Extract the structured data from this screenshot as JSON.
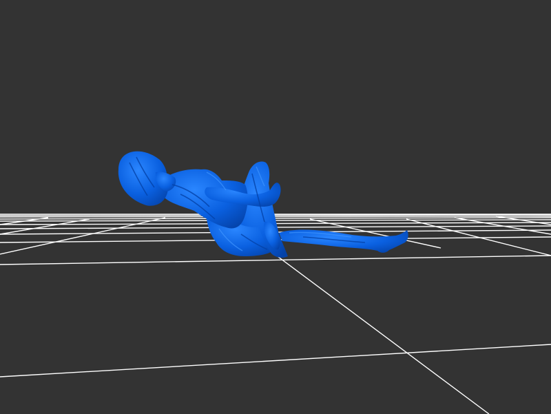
{
  "viewer": {
    "background_color": "#333333",
    "grid_color": "#ffffff",
    "model_color": "#0a60e0",
    "model_highlight": "#2a86ff",
    "model_shadow": "#0442a8",
    "model_name": "reclining-figure-model"
  }
}
